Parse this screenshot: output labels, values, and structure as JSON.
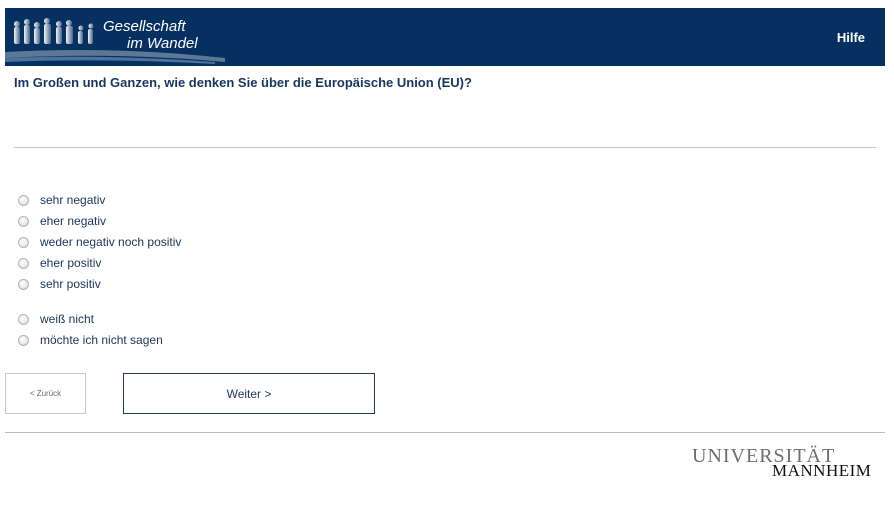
{
  "header": {
    "logo_line1": "Gesellschaft",
    "logo_line2": "im Wandel",
    "help_label": "Hilfe",
    "background_color": "#06305f"
  },
  "question": {
    "text": "Im Großen und Ganzen, wie denken Sie über die Europäische Union (EU)?"
  },
  "options": [
    "sehr negativ",
    "eher negativ",
    "weder negativ noch positiv",
    "eher positiv",
    "sehr positiv",
    "weiß nicht",
    "möchte ich nicht sagen"
  ],
  "navigation": {
    "back_label": "< Zurück",
    "next_label": "Weiter >"
  },
  "footer": {
    "university_line1": "UNIVERSITÄT",
    "university_line2": "MANNHEIM"
  }
}
